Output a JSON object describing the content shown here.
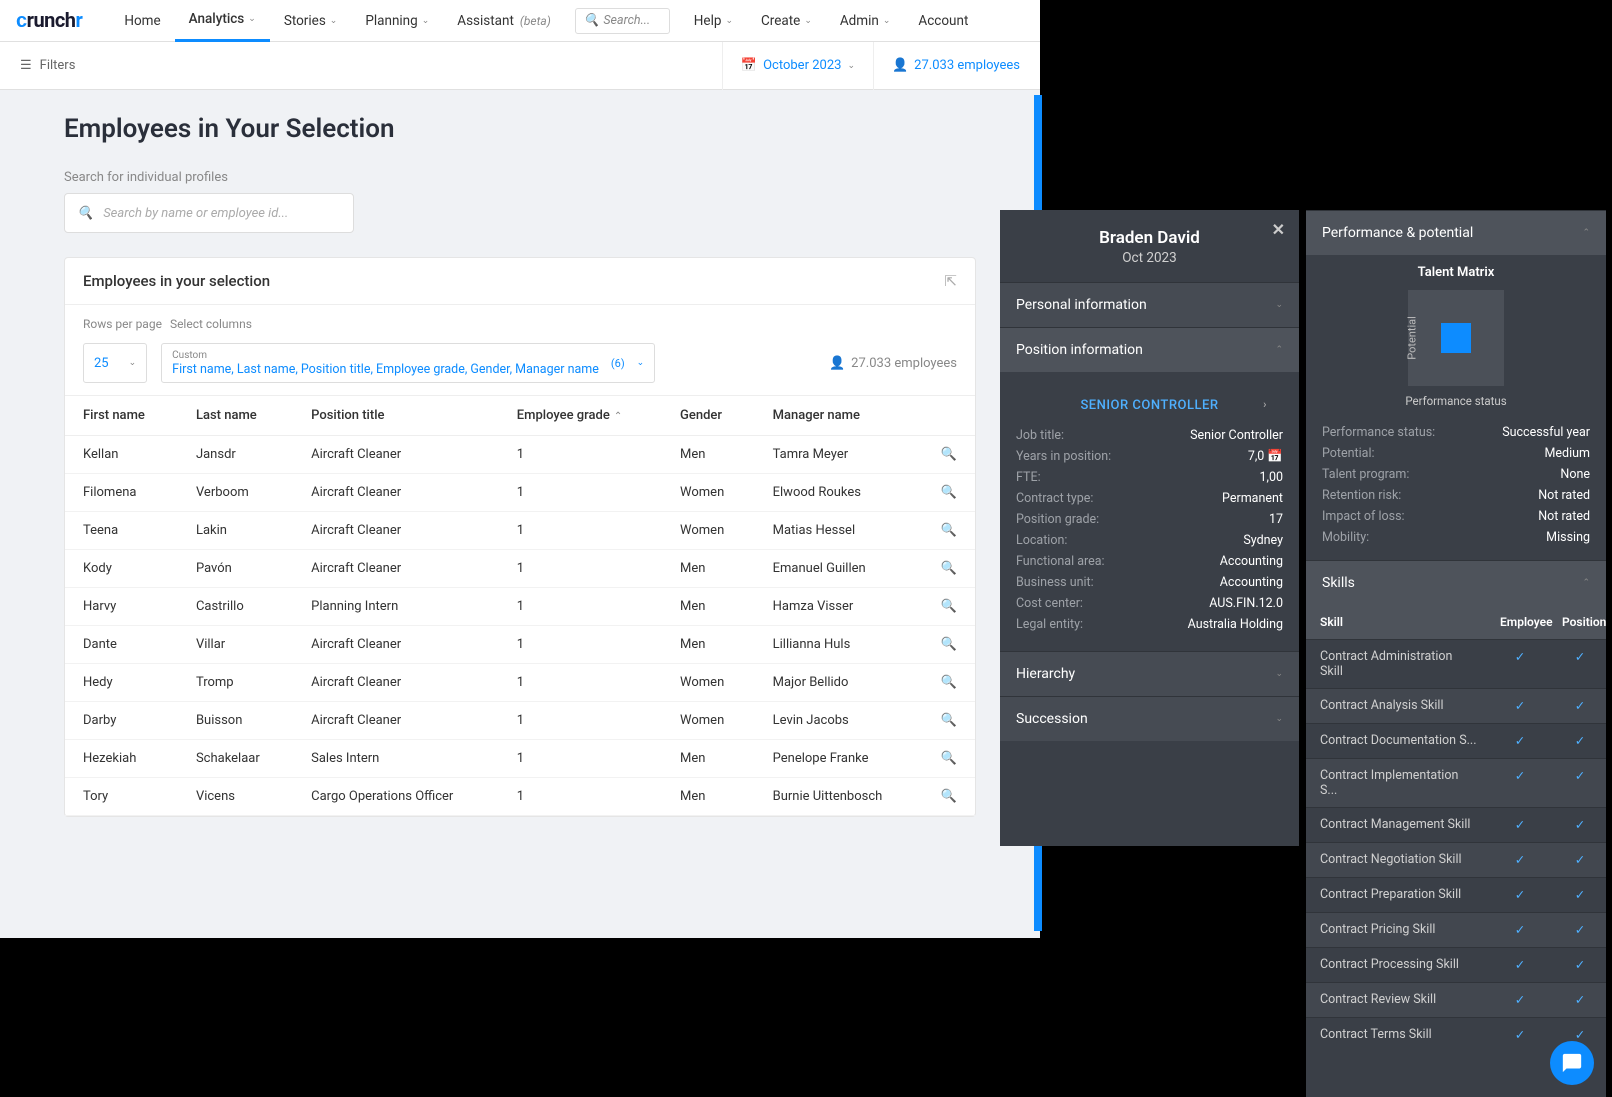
{
  "brand": {
    "name": "crunchr"
  },
  "nav": {
    "items": [
      "Home",
      "Analytics",
      "Stories",
      "Planning",
      "Assistant",
      "Help",
      "Create",
      "Admin",
      "Account"
    ],
    "beta_label": "(beta)",
    "search_placeholder": "Search..."
  },
  "subbar": {
    "filters": "Filters",
    "date": "October 2023",
    "employees": "27.033 employees"
  },
  "page": {
    "title": "Employees in Your Selection",
    "search_label": "Search for individual profiles",
    "search_placeholder": "Search by name or employee id..."
  },
  "table": {
    "card_title": "Employees in your selection",
    "rows_label": "Rows per page",
    "rows_value": "25",
    "cols_label": "Select columns",
    "custom_tag": "Custom",
    "cols_summary": "First name, Last name, Position title, Employee grade, Gender, Manager name",
    "cols_count": "(6)",
    "employees": "27.033 employees",
    "headers": [
      "First name",
      "Last name",
      "Position title",
      "Employee grade",
      "Gender",
      "Manager name"
    ],
    "rows": [
      {
        "first": "Kellan",
        "last": "Jansdr",
        "title": "Aircraft Cleaner",
        "grade": "1",
        "gender": "Men",
        "manager": "Tamra Meyer"
      },
      {
        "first": "Filomena",
        "last": "Verboom",
        "title": "Aircraft Cleaner",
        "grade": "1",
        "gender": "Women",
        "manager": "Elwood Roukes"
      },
      {
        "first": "Teena",
        "last": "Lakin",
        "title": "Aircraft Cleaner",
        "grade": "1",
        "gender": "Women",
        "manager": "Matias Hessel"
      },
      {
        "first": "Kody",
        "last": "Pavón",
        "title": "Aircraft Cleaner",
        "grade": "1",
        "gender": "Men",
        "manager": "Emanuel Guillen"
      },
      {
        "first": "Harvy",
        "last": "Castrillo",
        "title": "Planning Intern",
        "grade": "1",
        "gender": "Men",
        "manager": "Hamza Visser"
      },
      {
        "first": "Dante",
        "last": "Villar",
        "title": "Aircraft Cleaner",
        "grade": "1",
        "gender": "Men",
        "manager": "Lillianna Huls"
      },
      {
        "first": "Hedy",
        "last": "Tromp",
        "title": "Aircraft Cleaner",
        "grade": "1",
        "gender": "Women",
        "manager": "Major Bellido"
      },
      {
        "first": "Darby",
        "last": "Buisson",
        "title": "Aircraft Cleaner",
        "grade": "1",
        "gender": "Women",
        "manager": "Levin Jacobs"
      },
      {
        "first": "Hezekiah",
        "last": "Schakelaar",
        "title": "Sales Intern",
        "grade": "1",
        "gender": "Men",
        "manager": "Penelope Franke"
      },
      {
        "first": "Tory",
        "last": "Vicens",
        "title": "Cargo Operations Officer",
        "grade": "1",
        "gender": "Men",
        "manager": "Burnie Uittenbosch"
      }
    ]
  },
  "profile": {
    "name": "Braden David",
    "date": "Oct 2023",
    "sections": {
      "personal": "Personal information",
      "position": "Position information",
      "hierarchy": "Hierarchy",
      "succession": "Succession"
    },
    "position_title": "SENIOR CONTROLLER",
    "position": [
      {
        "k": "Job title:",
        "v": "Senior Controller"
      },
      {
        "k": "Years in position:",
        "v": "7,0 📅"
      },
      {
        "k": "FTE:",
        "v": "1,00"
      },
      {
        "k": "Contract type:",
        "v": "Permanent"
      },
      {
        "k": "Position grade:",
        "v": "17"
      },
      {
        "k": "Location:",
        "v": "Sydney"
      },
      {
        "k": "Functional area:",
        "v": "Accounting"
      },
      {
        "k": "Business unit:",
        "v": "Accounting"
      },
      {
        "k": "Cost center:",
        "v": "AUS.FIN.12.0"
      },
      {
        "k": "Legal entity:",
        "v": "Australia Holding"
      }
    ]
  },
  "perf": {
    "header": "Performance & potential",
    "matrix_title": "Talent Matrix",
    "ylabel": "Potential",
    "xlabel": "Performance status",
    "rows": [
      {
        "k": "Performance status:",
        "v": "Successful year"
      },
      {
        "k": "Potential:",
        "v": "Medium"
      },
      {
        "k": "Talent program:",
        "v": "None"
      },
      {
        "k": "Retention risk:",
        "v": "Not rated"
      },
      {
        "k": "Impact of loss:",
        "v": "Not rated"
      },
      {
        "k": "Mobility:",
        "v": "Missing"
      }
    ]
  },
  "skills": {
    "header": "Skills",
    "cols": [
      "Skill",
      "Employee",
      "Position"
    ],
    "rows": [
      "Contract Administration Skill",
      "Contract Analysis Skill",
      "Contract Documentation S...",
      "Contract Implementation S...",
      "Contract Management Skill",
      "Contract Negotiation Skill",
      "Contract Preparation Skill",
      "Contract Pricing Skill",
      "Contract Processing Skill",
      "Contract Review Skill",
      "Contract Terms Skill"
    ]
  }
}
